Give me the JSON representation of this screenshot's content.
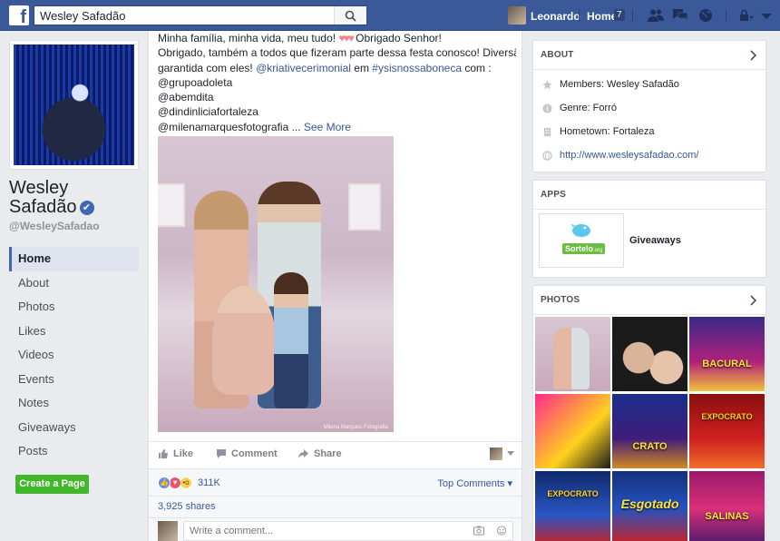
{
  "topbar": {
    "search_value": "Wesley Safadão",
    "user_name": "Leonardo",
    "home_label": "Home",
    "home_count": "7",
    "brand_color": "#3b5998"
  },
  "page": {
    "name_line1": "Wesley",
    "name_line2": "Safadão",
    "verified_mark": "✔",
    "handle": "@WesleySafadao"
  },
  "nav": {
    "items": [
      {
        "label": "Home",
        "active": true
      },
      {
        "label": "About"
      },
      {
        "label": "Photos"
      },
      {
        "label": "Likes"
      },
      {
        "label": "Videos"
      },
      {
        "label": "Events"
      },
      {
        "label": "Notes"
      },
      {
        "label": "Giveaways"
      },
      {
        "label": "Posts"
      }
    ],
    "create_page_label": "Create a Page"
  },
  "post": {
    "line1_a": "Minha família, minha vida, meu tudo! ",
    "line1_hearts": "♥♥♥",
    "line1_b": " Obrigado Senhor!",
    "line2": "Obrigado, também a todos que fizeram parte dessa festa conosco! Diversão",
    "line3_a": "garantida com eles! ",
    "line3_mention": "@kriativecerimonial",
    "line3_b": " em ",
    "line3_hashtag": "#ysisnossaboneca",
    "line3_c": " com :",
    "line4": "@grupoadoleta",
    "line5": "@abemdita",
    "line6": "@dindinliciafortaleza",
    "line7_a": "@milenamarquesfotografia ... ",
    "line7_more": "See More",
    "photo_watermark": "Milena Marques Fotografia",
    "actions": {
      "like": "Like",
      "comment": "Comment",
      "share": "Share"
    },
    "reaction_count": "311K",
    "top_comments_label": "Top Comments",
    "shares_label": "3,925 shares",
    "comment_placeholder": "Write a comment..."
  },
  "about": {
    "title": "ABOUT",
    "members": "Members: Wesley Safadão",
    "genre": "Genre: Forró",
    "hometown": "Hometown: Fortaleza",
    "website": "http://www.wesleysafadao.com/"
  },
  "apps": {
    "title": "APPS",
    "app_name": "Giveaways",
    "app_logo_text": "Sortelo",
    "app_logo_suffix": ".org"
  },
  "photos": {
    "title": "PHOTOS",
    "cells": [
      {
        "text": ""
      },
      {
        "text": ""
      },
      {
        "text": "BACURAL"
      },
      {
        "text": ""
      },
      {
        "text": "CRATO"
      },
      {
        "text": "EXPOCRATO"
      },
      {
        "text": "EXPOCRATO"
      },
      {
        "text": "Esgotado"
      },
      {
        "text": "SALINAS"
      }
    ]
  }
}
